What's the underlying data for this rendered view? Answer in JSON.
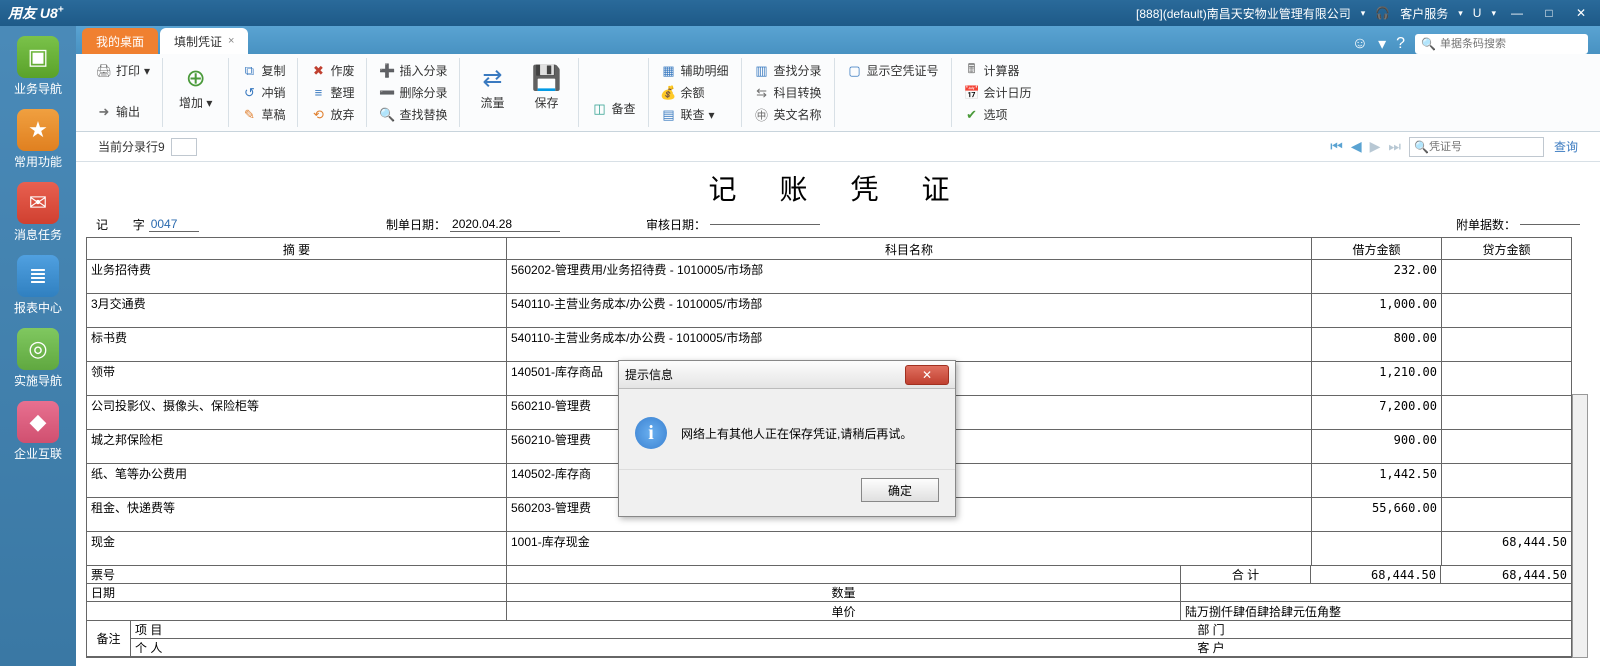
{
  "titlebar": {
    "app_name": "用友 U8",
    "account_info": "[888](default)南昌天安物业管理有限公司",
    "service_label": "客户服务",
    "u_label": "U"
  },
  "sidebar": {
    "items": [
      {
        "label": "业务导航"
      },
      {
        "label": "常用功能"
      },
      {
        "label": "消息任务"
      },
      {
        "label": "报表中心"
      },
      {
        "label": "实施导航"
      },
      {
        "label": "企业互联"
      }
    ]
  },
  "tabs": {
    "home": "我的桌面",
    "active": "填制凭证"
  },
  "search": {
    "placeholder": "单据条码搜索"
  },
  "ribbon": {
    "print": "打印",
    "output": "输出",
    "add": "增加",
    "copy": "复制",
    "offset": "冲销",
    "draft": "草稿",
    "invalid": "作废",
    "tidy": "整理",
    "abandon": "放弃",
    "insert_entry": "插入分录",
    "delete_entry": "删除分录",
    "find_replace": "查找替换",
    "flow": "流量",
    "save": "保存",
    "backup": "备查",
    "aux_detail": "辅助明细",
    "balance": "余额",
    "linked": "联查",
    "find_entry": "查找分录",
    "acct_switch": "科目转换",
    "en_name": "英文名称",
    "show_empty": "显示空凭证号",
    "calc": "计算器",
    "acct_cal": "会计日历",
    "options": "选项"
  },
  "info": {
    "current_entry_label": "当前分录行9",
    "voucher_no_placeholder": "凭证号",
    "query": "查询"
  },
  "voucher": {
    "title": "记 账 凭 证",
    "zi_label": "记",
    "zi_label2": "字",
    "number": "0047",
    "make_date_label": "制单日期：",
    "make_date": "2020.04.28",
    "audit_date_label": "审核日期：",
    "audit_date": "",
    "attach_label": "附单据数：",
    "cols": {
      "summary": "摘 要",
      "subject": "科目名称",
      "debit": "借方金额",
      "credit": "贷方金额"
    },
    "rows": [
      {
        "s": "业务招待费",
        "a": "560202-管理费用/业务招待费 - 1010005/市场部",
        "d": "232.00",
        "c": ""
      },
      {
        "s": "3月交通费",
        "a": "540110-主营业务成本/办公费 - 1010005/市场部",
        "d": "1,000.00",
        "c": ""
      },
      {
        "s": "标书费",
        "a": "540110-主营业务成本/办公费 - 1010005/市场部",
        "d": "800.00",
        "c": ""
      },
      {
        "s": "领带",
        "a": "140501-库存商品",
        "d": "1,210.00",
        "c": ""
      },
      {
        "s": "公司投影仪、摄像头、保险柜等",
        "a": "560210-管理费",
        "d": "7,200.00",
        "c": ""
      },
      {
        "s": "城之邦保险柜",
        "a": "560210-管理费",
        "d": "900.00",
        "c": ""
      },
      {
        "s": "纸、笔等办公费用",
        "a": "140502-库存商",
        "d": "1,442.50",
        "c": ""
      },
      {
        "s": "租金、快递费等",
        "a": "560203-管理费",
        "d": "55,660.00",
        "c": ""
      },
      {
        "s": "现金",
        "a": "1001-库存现金",
        "d": "",
        "c": "68,444.50"
      }
    ],
    "foot": {
      "ticket_label": "票号",
      "date_label": "日期",
      "qty_label": "数量",
      "price_label": "单价",
      "total_label": "合 计",
      "debit_total": "68,444.50",
      "credit_total": "68,444.50",
      "cn_amount": "陆万捌仟肆佰肆拾肆元伍角整",
      "remark_label": "备注",
      "proj_label": "项 目",
      "dept_label": "部 门",
      "person_label": "个 人",
      "cust_label": "客 户"
    }
  },
  "dialog": {
    "title": "提示信息",
    "message": "网络上有其他人正在保存凭证,请稍后再试。",
    "ok": "确定"
  }
}
